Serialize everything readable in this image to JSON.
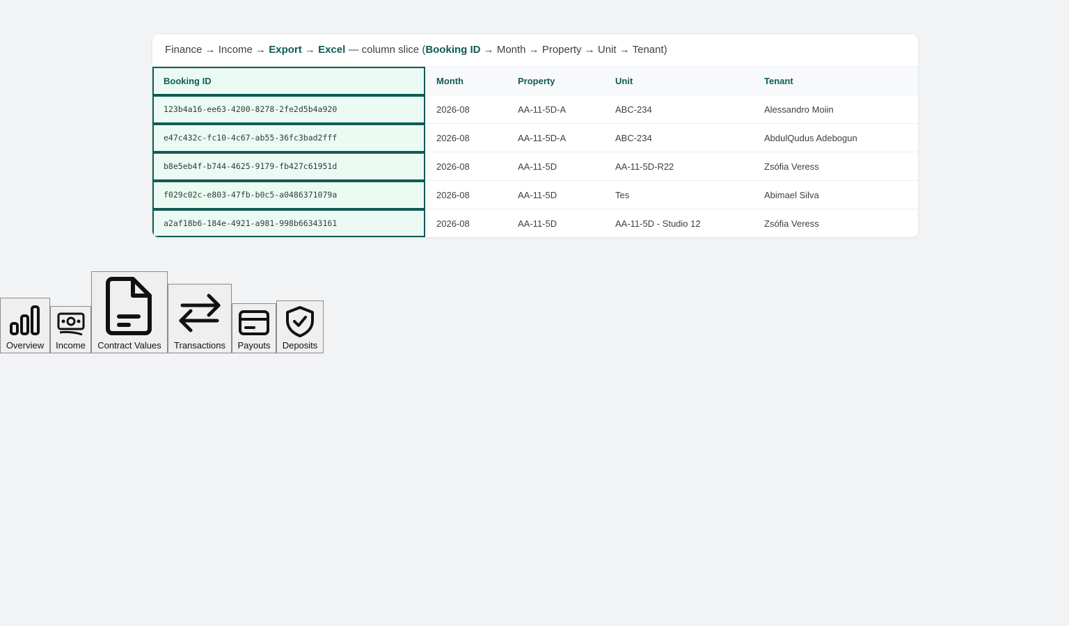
{
  "caption": {
    "p1": "Finance → Income → ",
    "p2": "Export → Excel",
    "p3": " — column slice (",
    "p4": "Booking ID",
    "p5": " → Month → Property → Unit → Tenant)"
  },
  "table": {
    "headers": [
      "Booking ID",
      "Month",
      "Property",
      "Unit",
      "Tenant"
    ],
    "rows": [
      [
        "123b4a16-ee63-4200-8278-2fe2d5b4a920",
        "2026-08",
        "AA-11-5D-A",
        "ABC-234",
        "Alessandro Moiin"
      ],
      [
        "e47c432c-fc10-4c67-ab55-36fc3bad2fff",
        "2026-08",
        "AA-11-5D-A",
        "ABC-234",
        "AbdulQudus Adebogun"
      ],
      [
        "b8e5eb4f-b744-4625-9179-fb427c61951d",
        "2026-08",
        "AA-11-5D",
        "AA-11-5D-R22",
        "Zsófia Veress"
      ],
      [
        "f029c02c-e803-47fb-b0c5-a0486371079a",
        "2026-08",
        "AA-11-5D",
        "Tes",
        "Abimael Silva"
      ],
      [
        "a2af18b6-184e-4921-a981-998b66343161",
        "2026-08",
        "AA-11-5D",
        "AA-11-5D - Studio 12",
        "Zsófia Veress"
      ]
    ]
  },
  "nav": {
    "overview": "Overview",
    "income": "Income",
    "contract_values": "Contract Values",
    "transactions": "Transactions",
    "payouts": "Payouts",
    "deposits": "Deposits"
  },
  "colors": {
    "accent": "#0f5b54",
    "highlight": "#ebfbf3"
  }
}
